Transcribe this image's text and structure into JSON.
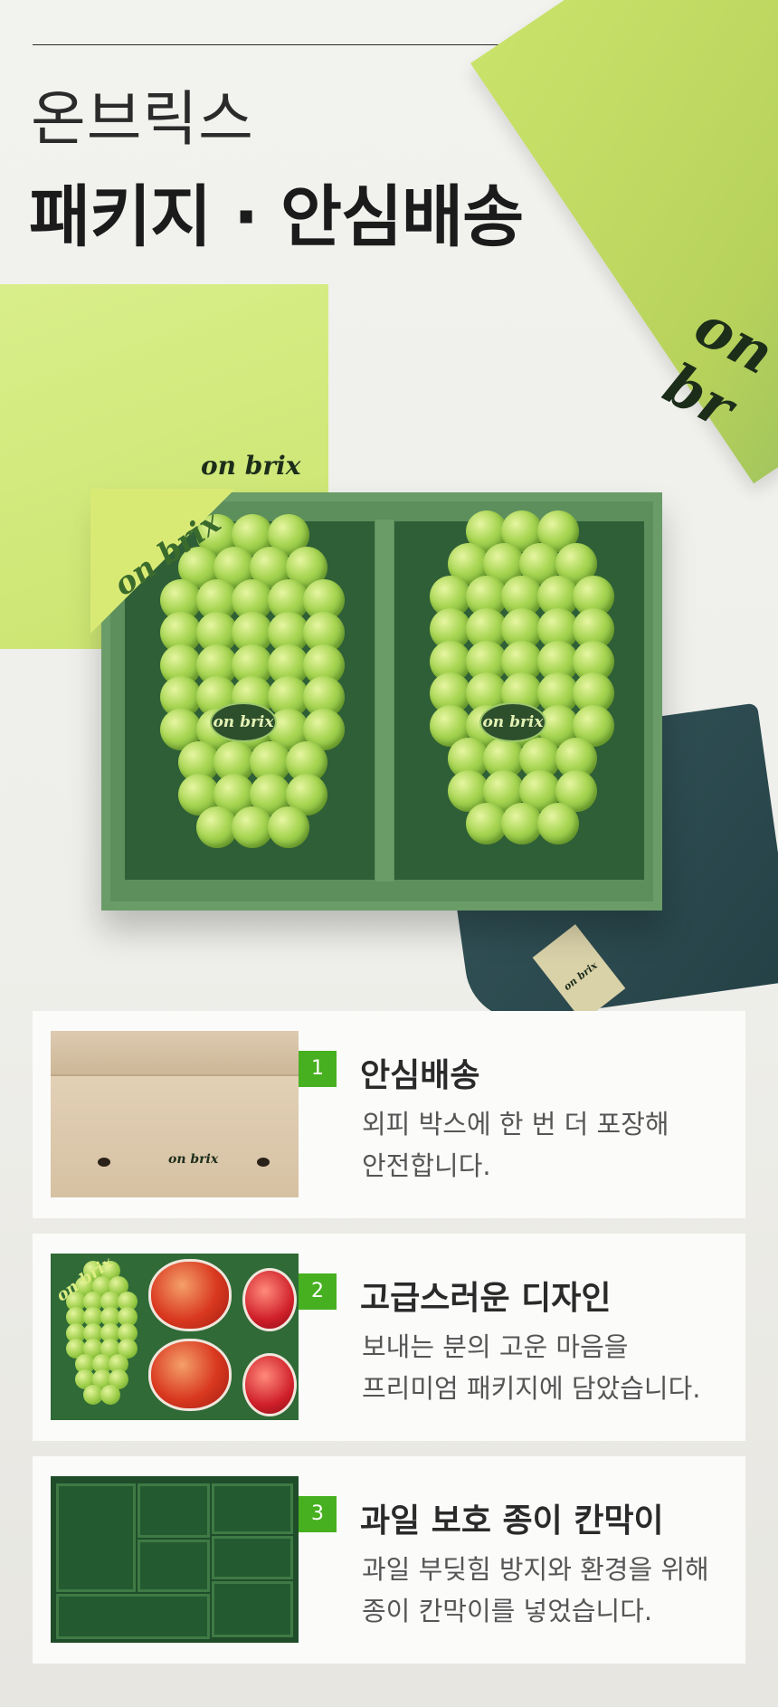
{
  "header": {
    "brand": "온브릭스",
    "title": "패키지 · 안심배송"
  },
  "hero": {
    "sheet_logo": "on brix",
    "lid_logo": "on br",
    "ribbon_logo": "on brix",
    "grape_tag_left": "on brix",
    "grape_tag_right": "on brix",
    "cloth_tag": "on brix"
  },
  "features": [
    {
      "number": "1",
      "title": "안심배송",
      "description": "외피 박스에 한 번 더 포장해\n안전합니다.",
      "image_logo": "on brix"
    },
    {
      "number": "2",
      "title": "고급스러운 디자인",
      "description": "보내는 분의 고운 마음을\n프리미엄 패키지에 담았습니다.",
      "image_logo": "on brix"
    },
    {
      "number": "3",
      "title": "과일 보호 종이 칸막이",
      "description": "과일 부딪힘 방지와 환경을 위해\n종이 칸막이를 넣었습니다."
    }
  ],
  "colors": {
    "accent_green": "#47b020",
    "lime": "#c9e46d",
    "box_green": "#6a9c68"
  }
}
